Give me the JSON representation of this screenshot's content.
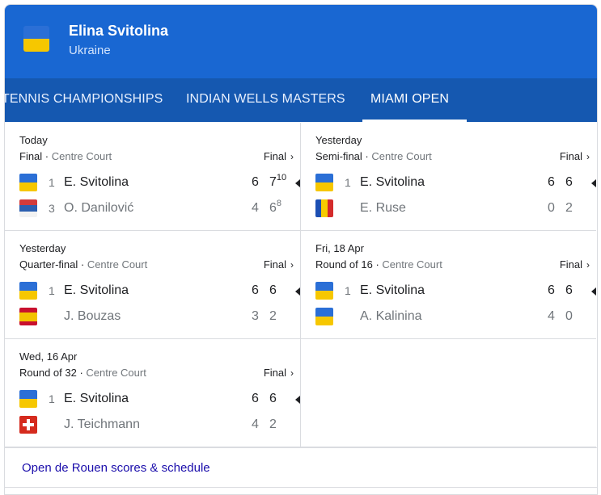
{
  "player": {
    "name": "Elina Svitolina",
    "country": "Ukraine"
  },
  "tabs": [
    {
      "label": "TENNIS CHAMPIONSHIPS"
    },
    {
      "label": "INDIAN WELLS MASTERS"
    },
    {
      "label": "MIAMI OPEN"
    }
  ],
  "matches": [
    {
      "when": "Today",
      "round": "Final",
      "court": "Centre Court",
      "status": "Final",
      "p1": {
        "flag": "ukraine-flag-icon",
        "seed": "1",
        "name": "E. Svitolina",
        "s1": "6",
        "s2": "7",
        "s2sup": "10"
      },
      "p2": {
        "flag": "serbia-flag-icon",
        "seed": "3",
        "name": "O. Danilović",
        "s1": "4",
        "s2": "6",
        "s2sup": "8"
      }
    },
    {
      "when": "Yesterday",
      "round": "Semi-final",
      "court": "Centre Court",
      "status": "Final",
      "p1": {
        "flag": "ukraine-flag-icon",
        "seed": "1",
        "name": "E. Svitolina",
        "s1": "6",
        "s2": "6"
      },
      "p2": {
        "flag": "romania-flag-icon",
        "seed": "",
        "name": "E. Ruse",
        "s1": "0",
        "s2": "2"
      }
    },
    {
      "when": "Yesterday",
      "round": "Quarter-final",
      "court": "Centre Court",
      "status": "Final",
      "p1": {
        "flag": "ukraine-flag-icon",
        "seed": "1",
        "name": "E. Svitolina",
        "s1": "6",
        "s2": "6"
      },
      "p2": {
        "flag": "spain-flag-icon",
        "seed": "",
        "name": "J. Bouzas",
        "s1": "3",
        "s2": "2"
      }
    },
    {
      "when": "Fri, 18 Apr",
      "round": "Round of 16",
      "court": "Centre Court",
      "status": "Final",
      "p1": {
        "flag": "ukraine-flag-icon",
        "seed": "1",
        "name": "E. Svitolina",
        "s1": "6",
        "s2": "6"
      },
      "p2": {
        "flag": "ukraine-flag-icon",
        "seed": "",
        "name": "A. Kalinina",
        "s1": "4",
        "s2": "0"
      }
    },
    {
      "when": "Wed, 16 Apr",
      "round": "Round of 32",
      "court": "Centre Court",
      "status": "Final",
      "p1": {
        "flag": "ukraine-flag-icon",
        "seed": "1",
        "name": "E. Svitolina",
        "s1": "6",
        "s2": "6"
      },
      "p2": {
        "flag": "switzerland-flag-icon",
        "seed": "",
        "name": "J. Teichmann",
        "s1": "4",
        "s2": "2"
      }
    }
  ],
  "footer": {
    "link": "Open de Rouen scores & schedule"
  },
  "colors": {
    "header_bg": "#1967d2",
    "tabs_bg": "#1558b0",
    "link": "#1a0dab"
  }
}
